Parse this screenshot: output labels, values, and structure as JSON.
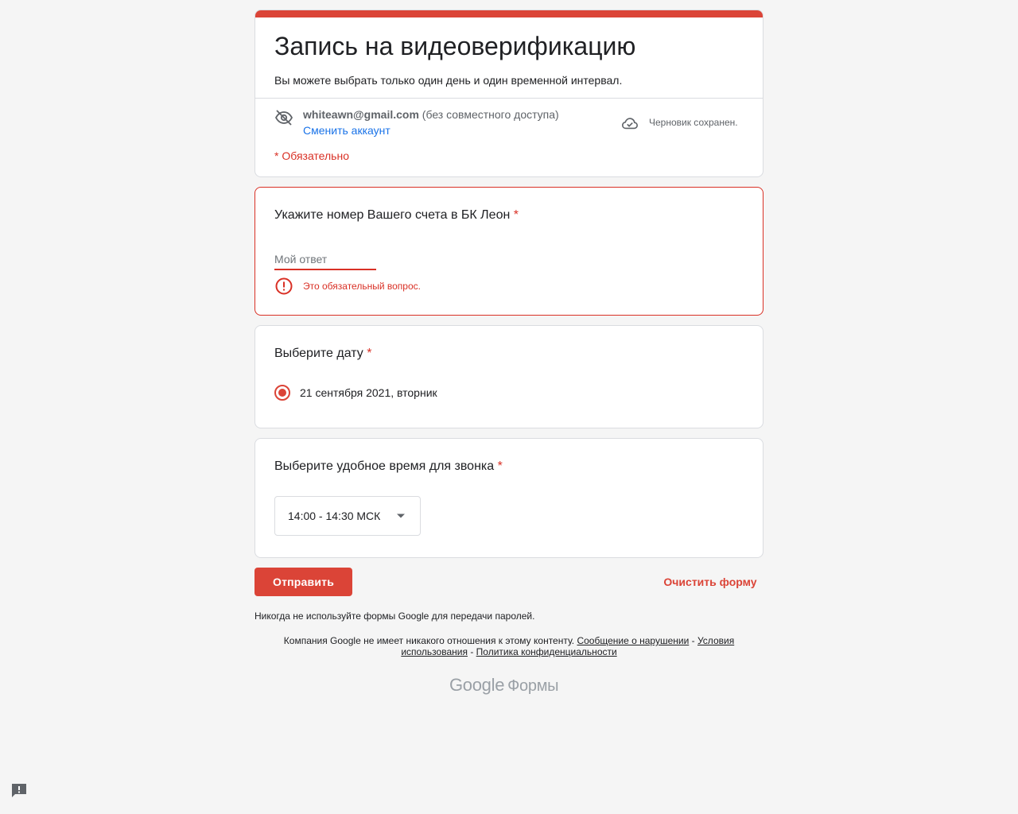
{
  "form": {
    "title": "Запись на видеоверификацию",
    "description": "Вы можете выбрать только один день и один временной интервал.",
    "account_email": "whiteawn@gmail.com",
    "account_sharing": "(без совместного доступа)",
    "switch_account": "Сменить аккаунт",
    "draft_status": "Черновик сохранен.",
    "required_note": "* Обязательно"
  },
  "questions": {
    "account_number": {
      "title": "Укажите номер Вашего счета в БК Леон",
      "required_mark": "*",
      "placeholder": "Мой ответ",
      "value": "",
      "error": "Это обязательный вопрос."
    },
    "date": {
      "title": "Выберите дату",
      "required_mark": "*",
      "option": "21 сентября 2021, вторник",
      "selected": true
    },
    "time": {
      "title": "Выберите удобное время для звонка",
      "required_mark": "*",
      "selected_value": "14:00 - 14:30 МСК"
    }
  },
  "actions": {
    "submit_label": "Отправить",
    "clear_label": "Очистить форму"
  },
  "footer": {
    "password_warning": "Никогда не используйте формы Google для передачи паролей.",
    "disclaimer": "Компания Google не имеет никакого отношения к этому контенту.",
    "report_link": "Сообщение о нарушении",
    "terms_link": "Условия использования",
    "privacy_link": "Политика конфиденциальности",
    "separator": "-",
    "logo_google": "Google",
    "logo_forms": "Формы"
  },
  "icons": {
    "eye": "eye-off-icon",
    "cloud": "cloud-done-icon",
    "error": "error-icon",
    "arrow": "dropdown-arrow-icon",
    "feedback": "feedback-icon"
  },
  "colors": {
    "accent": "#db4437",
    "error": "#d93025",
    "link": "#1a73e8",
    "background": "#f5f5f5"
  }
}
